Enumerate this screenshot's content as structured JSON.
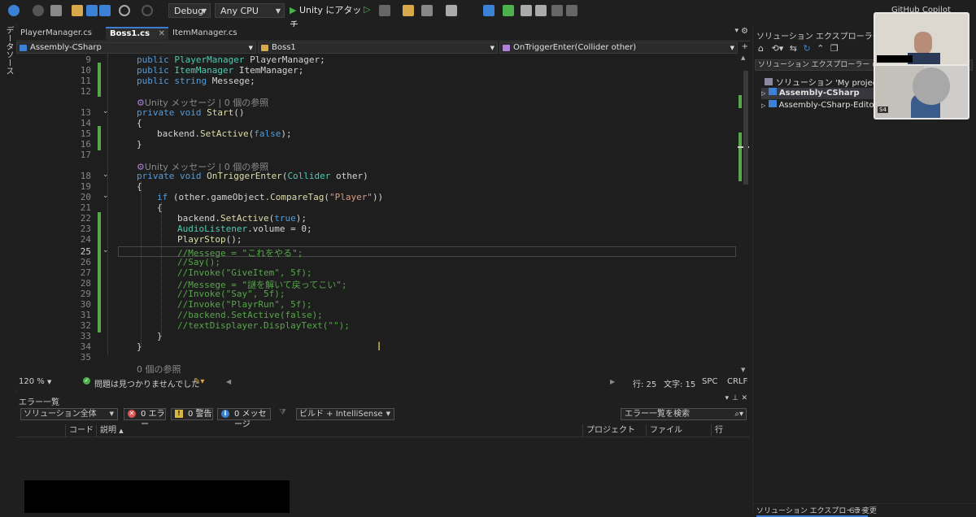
{
  "toolbar": {
    "config_select": "Debug",
    "platform_select": "Any CPU",
    "attach_button": "Unity にアタッチ",
    "copilot_label": "GitHub Copilot"
  },
  "left_strip": {
    "label": "データソース"
  },
  "tabs": [
    {
      "label": "PlayerManager.cs"
    },
    {
      "label": "Boss1.cs"
    },
    {
      "label": "ItemManager.cs"
    }
  ],
  "navbar": {
    "project": "Assembly-CSharp",
    "class": "Boss1",
    "member": "OnTriggerEnter(Collider other)"
  },
  "editor": {
    "line_numbers": [
      "9",
      "10",
      "11",
      "12",
      "13",
      "14",
      "15",
      "16",
      "17",
      "18",
      "19",
      "20",
      "21",
      "22",
      "23",
      "24",
      "25",
      "26",
      "27",
      "28",
      "29",
      "30",
      "31",
      "32",
      "33",
      "34",
      "35"
    ],
    "ref_unity_1": "Unity メッセージ | 0 個の参照",
    "ref_unity_2": "Unity メッセージ | 0 個の参照",
    "ref_zero": "0 個の参照",
    "lines": {
      "l9_k": "public ",
      "l9_t": "PlayerManager",
      "l9_r": " PlayerManager;",
      "l10_k": "public ",
      "l10_t": "ItemManager",
      "l10_r": " ItemManager;",
      "l11_k": "public string",
      "l11_r": " Messege;",
      "l13_k": "private void ",
      "l13_m": "Start",
      "l13_r": "()",
      "l14": "{",
      "l15_a": "backend.",
      "l15_m": "SetActive",
      "l15_b": "(",
      "l15_k": "false",
      "l15_c": ");",
      "l16": "}",
      "l18_k": "private void ",
      "l18_m": "OnTriggerEnter",
      "l18_a": "(",
      "l18_t": "Collider",
      "l18_b": " other)",
      "l19": "{",
      "l20_k": "if",
      "l20_a": " (other.gameObject.",
      "l20_m": "CompareTag",
      "l20_b": "(",
      "l20_s": "\"Player\"",
      "l20_c": "))",
      "l21": "{",
      "l22_a": "backend.",
      "l22_m": "SetActive",
      "l22_b": "(",
      "l22_k": "true",
      "l22_c": ");",
      "l23_t": "AudioListener",
      "l23_a": ".volume = 0;",
      "l24_m": "PlayrStop",
      "l24_a": "();",
      "l25": "//Messege = \"これをやる\";",
      "l26": "//Say();",
      "l27": "//Invoke(\"GiveItem\", 5f);",
      "l28": "//Messege = \"謎を解いて戻ってこい\";",
      "l29": "//Invoke(\"Say\", 5f);",
      "l30": "//Invoke(\"PlayrRun\", 5f);",
      "l31": "//backend.SetActive(false);",
      "l32": "//textDisplayer.DisplayText(\"\");",
      "l33": "}",
      "l34": "}"
    }
  },
  "editor_status": {
    "zoom": "120 %",
    "issues": "問題は見つかりませんでした",
    "line": "行: 25",
    "col": "文字: 15",
    "spc": "SPC",
    "crlf": "CRLF"
  },
  "error_list": {
    "title": "エラー一覧",
    "scope_select": "ソリューション全体",
    "errors_btn": "0 エラー",
    "warnings_btn": "0 警告",
    "messages_btn": "0 メッセージ",
    "build_select": "ビルド + IntelliSense",
    "search_placeholder": "エラー一覧を検索",
    "columns": [
      "コード",
      "説明",
      "プロジェクト",
      "ファイル",
      "行"
    ]
  },
  "solution": {
    "title": "ソリューション エクスプローラー",
    "search": "ソリューション エクスプローラー の検索 (Ct",
    "root": "ソリューション 'My project' (2/2",
    "projects": [
      "Assembly-CSharp",
      "Assembly-CSharp-Editor"
    ],
    "bottom_tabs": [
      "ソリューション エクスプローラー",
      "Git 変更"
    ]
  },
  "video": {
    "tile_badge": "S4"
  },
  "colors": {
    "accent": "#3d7bd4",
    "change_bar": "#57a64a",
    "comment": "#57a64a",
    "keyword": "#569cd6",
    "type": "#4ec9b0"
  }
}
